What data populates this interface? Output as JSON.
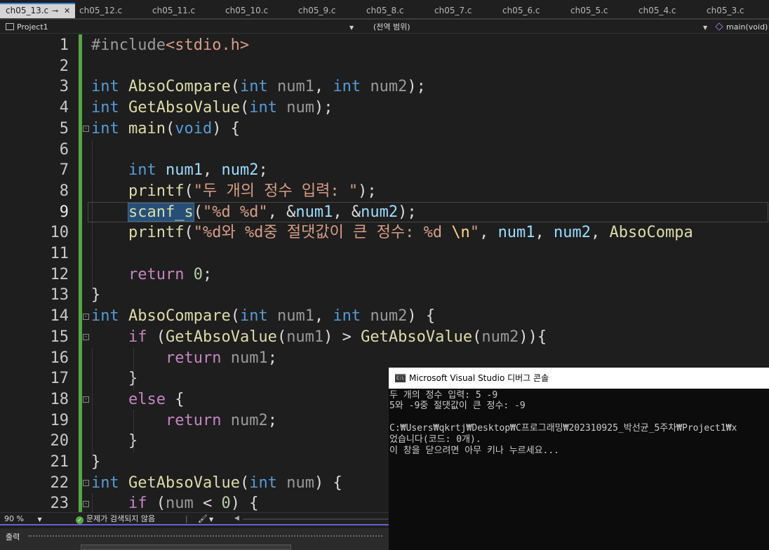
{
  "tabs": [
    {
      "label": "ch05_13.c",
      "pin": "⊸",
      "close": "✕",
      "active": true
    },
    {
      "label": "ch05_12.c"
    },
    {
      "label": "ch05_11.c"
    },
    {
      "label": "ch05_10.c"
    },
    {
      "label": "ch05_9.c"
    },
    {
      "label": "ch05_8.c"
    },
    {
      "label": "ch05_7.c"
    },
    {
      "label": "ch05_6.c"
    },
    {
      "label": "ch05_5.c"
    },
    {
      "label": "ch05_4.c"
    },
    {
      "label": "ch05_3.c"
    }
  ],
  "navbar": {
    "project": "Project1",
    "scope": "(전역 범위)",
    "function": "main(void)"
  },
  "editor": {
    "current_line": 9,
    "lines": [
      {
        "n": "1",
        "tokens": [
          [
            "pp",
            "#include"
          ],
          [
            "st",
            "<stdio.h>"
          ]
        ]
      },
      {
        "n": "2",
        "tokens": []
      },
      {
        "n": "3",
        "tokens": [
          [
            "kw",
            "int"
          ],
          [
            "",
            " "
          ],
          [
            "fn",
            "AbsoCompare"
          ],
          [
            "",
            "("
          ],
          [
            "kw",
            "int"
          ],
          [
            "",
            " "
          ],
          [
            "pa",
            "num1"
          ],
          [
            "",
            ", "
          ],
          [
            "kw",
            "int"
          ],
          [
            "",
            " "
          ],
          [
            "pa",
            "num2"
          ],
          [
            "",
            ");"
          ]
        ]
      },
      {
        "n": "4",
        "tokens": [
          [
            "kw",
            "int"
          ],
          [
            "",
            " "
          ],
          [
            "fn",
            "GetAbsoValue"
          ],
          [
            "",
            "("
          ],
          [
            "kw",
            "int"
          ],
          [
            "",
            " "
          ],
          [
            "pa",
            "num"
          ],
          [
            "",
            ");"
          ]
        ]
      },
      {
        "n": "5",
        "tokens": [
          [
            "kw",
            "int"
          ],
          [
            "",
            " "
          ],
          [
            "fn",
            "main"
          ],
          [
            "",
            "("
          ],
          [
            "kw",
            "void"
          ],
          [
            "",
            ") {"
          ]
        ]
      },
      {
        "n": "6",
        "tokens": []
      },
      {
        "n": "7",
        "tokens": [
          [
            "",
            "    "
          ],
          [
            "kw",
            "int"
          ],
          [
            "",
            " "
          ],
          [
            "pr",
            "num1"
          ],
          [
            "",
            ", "
          ],
          [
            "pr",
            "num2"
          ],
          [
            "",
            ";"
          ]
        ]
      },
      {
        "n": "8",
        "tokens": [
          [
            "",
            "    "
          ],
          [
            "fn",
            "printf"
          ],
          [
            "",
            "("
          ],
          [
            "st",
            "\"두 개의 정수 입력: \""
          ],
          [
            "",
            ");"
          ]
        ]
      },
      {
        "n": "9",
        "tokens": [
          [
            "",
            "    "
          ],
          [
            "fn sel",
            "scanf_s"
          ],
          [
            "",
            "("
          ],
          [
            "st",
            "\"%d %d\""
          ],
          [
            "",
            ", &"
          ],
          [
            "pr",
            "num1"
          ],
          [
            "",
            ", &"
          ],
          [
            "pr",
            "num2"
          ],
          [
            "",
            ");"
          ]
        ]
      },
      {
        "n": "10",
        "tokens": [
          [
            "",
            "    "
          ],
          [
            "fn",
            "printf"
          ],
          [
            "",
            "("
          ],
          [
            "st",
            "\"%d와 %d중 절댓값이 큰 정수: %d "
          ],
          [
            "esc",
            "\\n"
          ],
          [
            "st",
            "\""
          ],
          [
            "",
            ", "
          ],
          [
            "pr",
            "num1"
          ],
          [
            "",
            ", "
          ],
          [
            "pr",
            "num2"
          ],
          [
            "",
            ", "
          ],
          [
            "fn",
            "AbsoCompa"
          ]
        ]
      },
      {
        "n": "11",
        "tokens": []
      },
      {
        "n": "12",
        "tokens": [
          [
            "",
            "    "
          ],
          [
            "ct",
            "return"
          ],
          [
            "",
            " "
          ],
          [
            "nu",
            "0"
          ],
          [
            "",
            ";"
          ]
        ]
      },
      {
        "n": "13",
        "tokens": [
          [
            "",
            "}"
          ]
        ]
      },
      {
        "n": "14",
        "tokens": [
          [
            "kw",
            "int"
          ],
          [
            "",
            " "
          ],
          [
            "fn",
            "AbsoCompare"
          ],
          [
            "",
            "("
          ],
          [
            "kw",
            "int"
          ],
          [
            "",
            " "
          ],
          [
            "pa",
            "num1"
          ],
          [
            "",
            ", "
          ],
          [
            "kw",
            "int"
          ],
          [
            "",
            " "
          ],
          [
            "pa",
            "num2"
          ],
          [
            "",
            ") {"
          ]
        ]
      },
      {
        "n": "15",
        "tokens": [
          [
            "",
            "    "
          ],
          [
            "ct",
            "if"
          ],
          [
            "",
            " ("
          ],
          [
            "fn",
            "GetAbsoValue"
          ],
          [
            "",
            "("
          ],
          [
            "pa",
            "num1"
          ],
          [
            "",
            ") > "
          ],
          [
            "fn",
            "GetAbsoValue"
          ],
          [
            "",
            "("
          ],
          [
            "pa",
            "num2"
          ],
          [
            "",
            ")){"
          ]
        ]
      },
      {
        "n": "16",
        "tokens": [
          [
            "",
            "        "
          ],
          [
            "ct",
            "return"
          ],
          [
            "",
            " "
          ],
          [
            "pa",
            "num1"
          ],
          [
            "",
            ";"
          ]
        ]
      },
      {
        "n": "17",
        "tokens": [
          [
            "",
            "    }"
          ]
        ]
      },
      {
        "n": "18",
        "tokens": [
          [
            "",
            "    "
          ],
          [
            "ct",
            "else"
          ],
          [
            "",
            " {"
          ]
        ]
      },
      {
        "n": "19",
        "tokens": [
          [
            "",
            "        "
          ],
          [
            "ct",
            "return"
          ],
          [
            "",
            " "
          ],
          [
            "pa",
            "num2"
          ],
          [
            "",
            ";"
          ]
        ]
      },
      {
        "n": "20",
        "tokens": [
          [
            "",
            "    }"
          ]
        ]
      },
      {
        "n": "21",
        "tokens": [
          [
            "",
            "}"
          ]
        ]
      },
      {
        "n": "22",
        "tokens": [
          [
            "kw",
            "int"
          ],
          [
            "",
            " "
          ],
          [
            "fn",
            "GetAbsoValue"
          ],
          [
            "",
            "("
          ],
          [
            "kw",
            "int"
          ],
          [
            "",
            " "
          ],
          [
            "pa",
            "num"
          ],
          [
            "",
            ") {"
          ]
        ]
      },
      {
        "n": "23",
        "tokens": [
          [
            "",
            "    "
          ],
          [
            "ct",
            "if"
          ],
          [
            "",
            " ("
          ],
          [
            "pa",
            "num"
          ],
          [
            "",
            " < "
          ],
          [
            "nu",
            "0"
          ],
          [
            "",
            ") {"
          ]
        ]
      }
    ]
  },
  "statusbar": {
    "zoom": "90 %",
    "issues": "문제가 검색되지 않음"
  },
  "output_panel": {
    "title": "출력"
  },
  "console": {
    "title": "Microsoft Visual Studio 디버그 콘솔",
    "icon_text": "C:\\",
    "lines": [
      "두 개의 정수 입력: 5 -9",
      "5와 -9중 절댓값이 큰 정수: -9",
      "",
      "C:₩Users₩qkrtj₩Desktop₩C프로그래밍₩202310925_박선균_5주차₩Project1₩x",
      "었습니다(코드: 0개).",
      "이 창을 닫으려면 아무 키나 누르세요..."
    ]
  }
}
